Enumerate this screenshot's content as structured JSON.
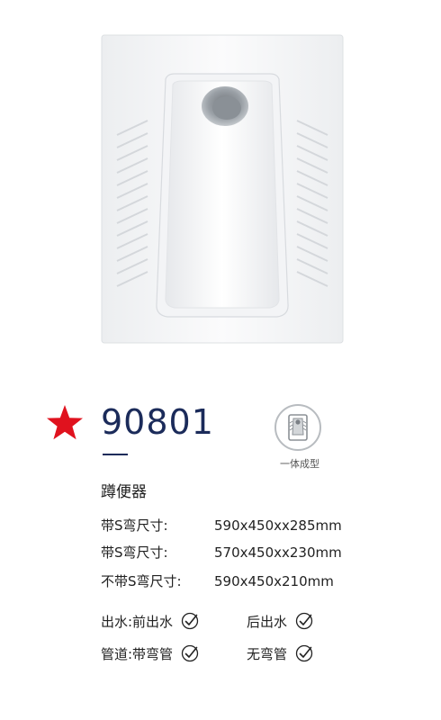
{
  "product": {
    "model": "90801",
    "name": "蹲便器",
    "badge_label": "一体成型",
    "image_icon": "squat-toilet-image",
    "star_color": "#e0121e",
    "model_color": "#1b2b5a"
  },
  "specs": [
    {
      "label": "带S弯尺寸:",
      "value": "590x450xx285mm"
    },
    {
      "label": "带S弯尺寸:",
      "value": "570x450xx230mm"
    },
    {
      "label": "不带S弯尺寸:",
      "value": "590x450x210mm"
    }
  ],
  "options": {
    "outlet": {
      "label": "出水:前出水",
      "second": "后出水"
    },
    "pipe": {
      "label": "管道:带弯管",
      "second": "无弯管"
    }
  }
}
